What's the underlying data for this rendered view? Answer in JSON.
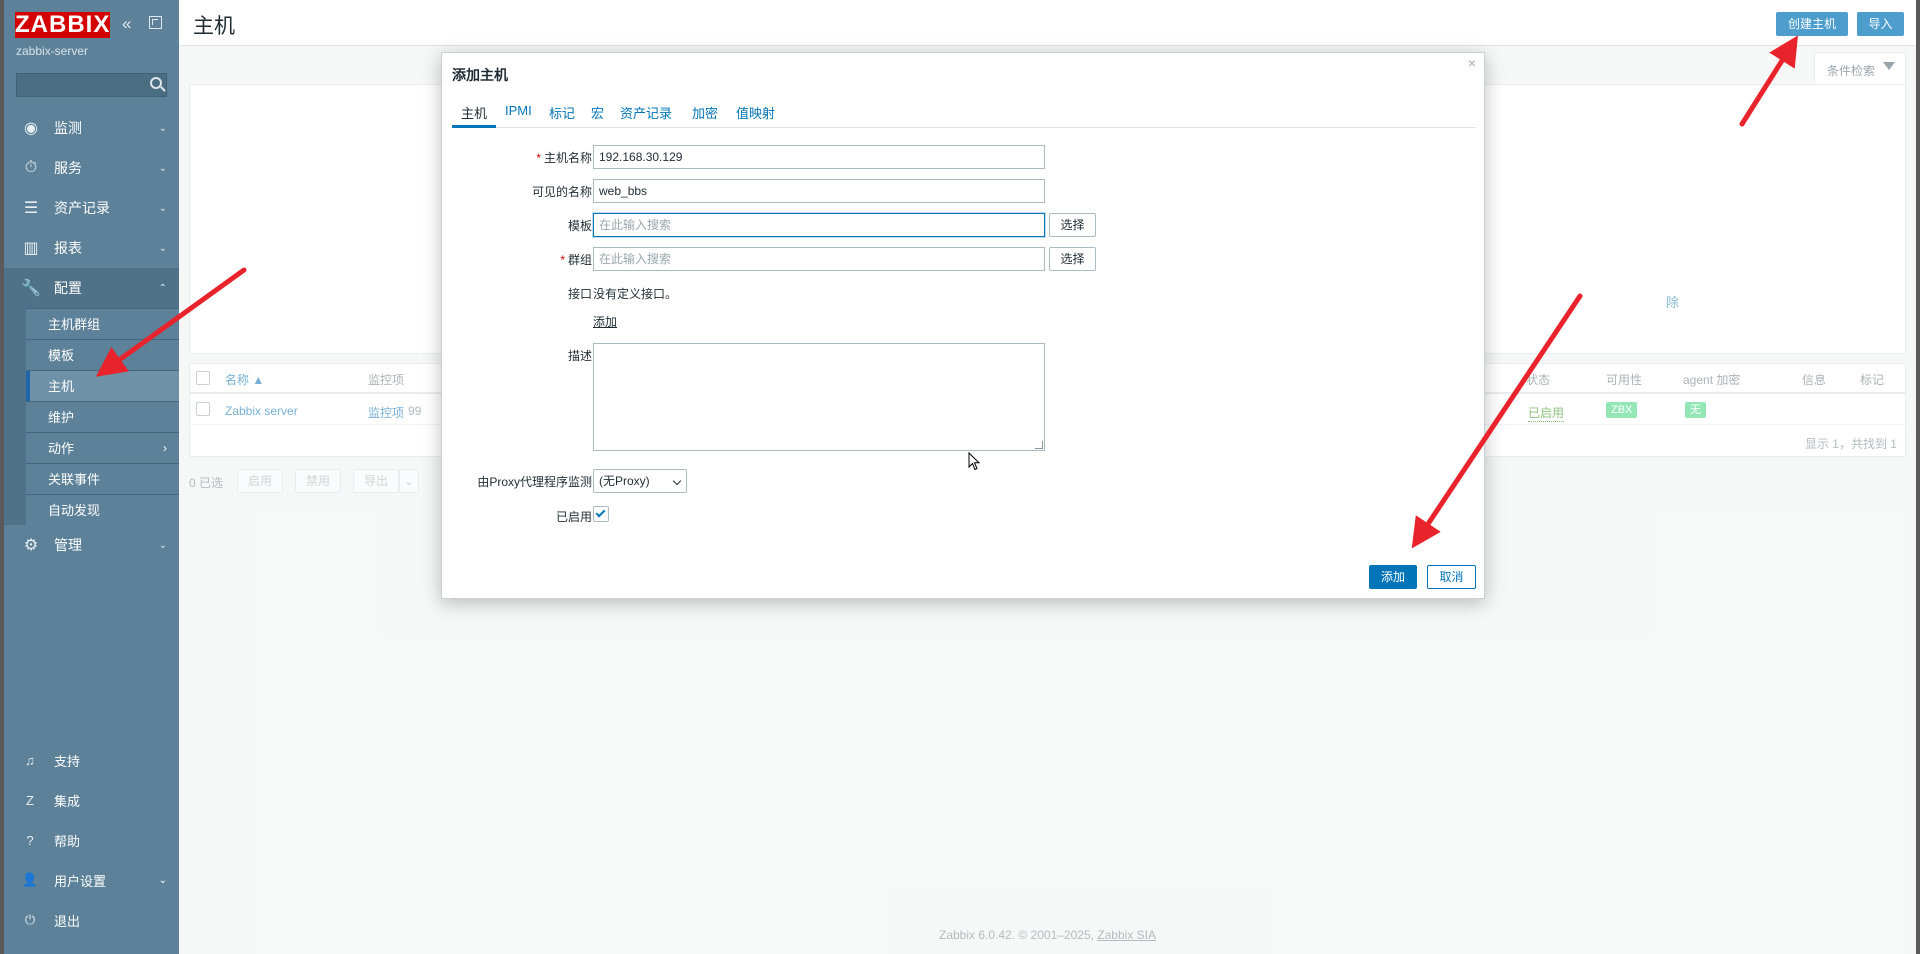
{
  "sidebar": {
    "logo": "ZABBIX",
    "server_name": "zabbix-server",
    "menu": [
      {
        "label": "监测",
        "icon": "eye-icon"
      },
      {
        "label": "服务",
        "icon": "stopwatch-icon"
      },
      {
        "label": "资产记录",
        "icon": "list-icon"
      },
      {
        "label": "报表",
        "icon": "bar-chart-icon"
      },
      {
        "label": "配置",
        "icon": "wrench-icon"
      }
    ],
    "config_submenu": [
      {
        "label": "主机群组"
      },
      {
        "label": "模板"
      },
      {
        "label": "主机"
      },
      {
        "label": "维护"
      },
      {
        "label": "动作"
      },
      {
        "label": "关联事件"
      },
      {
        "label": "自动发现"
      }
    ],
    "admin": {
      "label": "管理",
      "icon": "gear-icon"
    },
    "bottom": [
      {
        "label": "支持",
        "icon": "headset-icon"
      },
      {
        "label": "集成",
        "icon": "integrations-icon"
      },
      {
        "label": "帮助",
        "icon": "help-icon"
      },
      {
        "label": "用户设置",
        "icon": "user-icon"
      },
      {
        "label": "退出",
        "icon": "power-icon"
      }
    ]
  },
  "header": {
    "title": "主机",
    "create_host": "创建主机",
    "import": "导入"
  },
  "filter": {
    "tab_label": "条件检索",
    "remove_link": "除"
  },
  "table": {
    "headers": {
      "name": "名称 ▲",
      "items": "监控项",
      "status": "状态",
      "availability": "可用性",
      "agent_encryption": "agent 加密",
      "info": "信息",
      "tags": "标记"
    },
    "row": {
      "name": "Zabbix server",
      "items_link": "监控项",
      "items_count": "99",
      "status": "已启用",
      "availability": "ZBX",
      "encryption": "无"
    },
    "footer": "显示 1，共找到 1"
  },
  "mass_actions": {
    "selected": "0 已选",
    "enable": "启用",
    "disable": "禁用",
    "export": "导出"
  },
  "dialog": {
    "title": "添加主机",
    "tabs": [
      "主机",
      "IPMI",
      "标记",
      "宏",
      "资产记录",
      "加密",
      "值映射"
    ],
    "fields": {
      "host_name_label": "主机名称",
      "host_name_value": "192.168.30.129",
      "visible_name_label": "可见的名称",
      "visible_name_value": "web_bbs",
      "templates_label": "模板",
      "templates_placeholder": "在此输入搜索",
      "groups_label": "群组",
      "groups_placeholder": "在此输入搜索",
      "select_button": "选择",
      "interfaces_label": "接口",
      "interfaces_text": "没有定义接口。",
      "add_interface": "添加",
      "description_label": "描述",
      "proxy_label": "由Proxy代理程序监测",
      "proxy_value": "(无Proxy)",
      "enabled_label": "已启用"
    },
    "add_button": "添加",
    "cancel_button": "取消"
  },
  "footer": {
    "text": "Zabbix 6.0.42. © 2001–2025, ",
    "company": "Zabbix SIA"
  },
  "colors": {
    "sidebar": "#5c8198",
    "accent": "#0275b8",
    "logo": "#d40000",
    "annotation_arrow": "#e8232b"
  }
}
